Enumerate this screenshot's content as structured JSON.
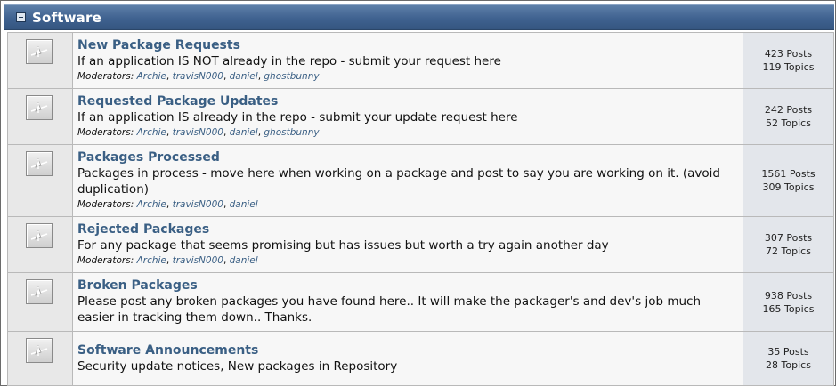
{
  "category": {
    "title": "Software"
  },
  "boards": [
    {
      "name": "New Package Requests",
      "description": "If an application IS NOT already in the repo - submit your request here",
      "moderators_label": "Moderators:",
      "moderators": [
        "Archie",
        "travisN000",
        "daniel",
        "ghostbunny"
      ],
      "posts": "423 Posts",
      "topics": "119 Topics"
    },
    {
      "name": "Requested Package Updates",
      "description": "If an application IS already in the repo - submit your update request here",
      "moderators_label": "Moderators:",
      "moderators": [
        "Archie",
        "travisN000",
        "daniel",
        "ghostbunny"
      ],
      "posts": "242 Posts",
      "topics": "52 Topics"
    },
    {
      "name": "Packages Processed",
      "description": "Packages in process - move here when working on a package and post to say you are working on it. (avoid duplication)",
      "moderators_label": "Moderators:",
      "moderators": [
        "Archie",
        "travisN000",
        "daniel"
      ],
      "posts": "1561 Posts",
      "topics": "309 Topics"
    },
    {
      "name": "Rejected Packages",
      "description": "For any package that seems promising but has issues but worth a try again another day",
      "moderators_label": "Moderators:",
      "moderators": [
        "Archie",
        "travisN000",
        "daniel"
      ],
      "posts": "307 Posts",
      "topics": "72 Topics"
    },
    {
      "name": "Broken Packages",
      "description": "Please post any broken packages you have found here.. It will make the packager's and dev's job much easier in tracking them down.. Thanks.",
      "moderators_label": "",
      "moderators": [],
      "posts": "938 Posts",
      "topics": "165 Topics"
    },
    {
      "name": "Software Announcements",
      "description": "Security update notices, New packages in Repository",
      "moderators_label": "",
      "moderators": [],
      "posts": "35 Posts",
      "topics": "28 Topics"
    }
  ]
}
